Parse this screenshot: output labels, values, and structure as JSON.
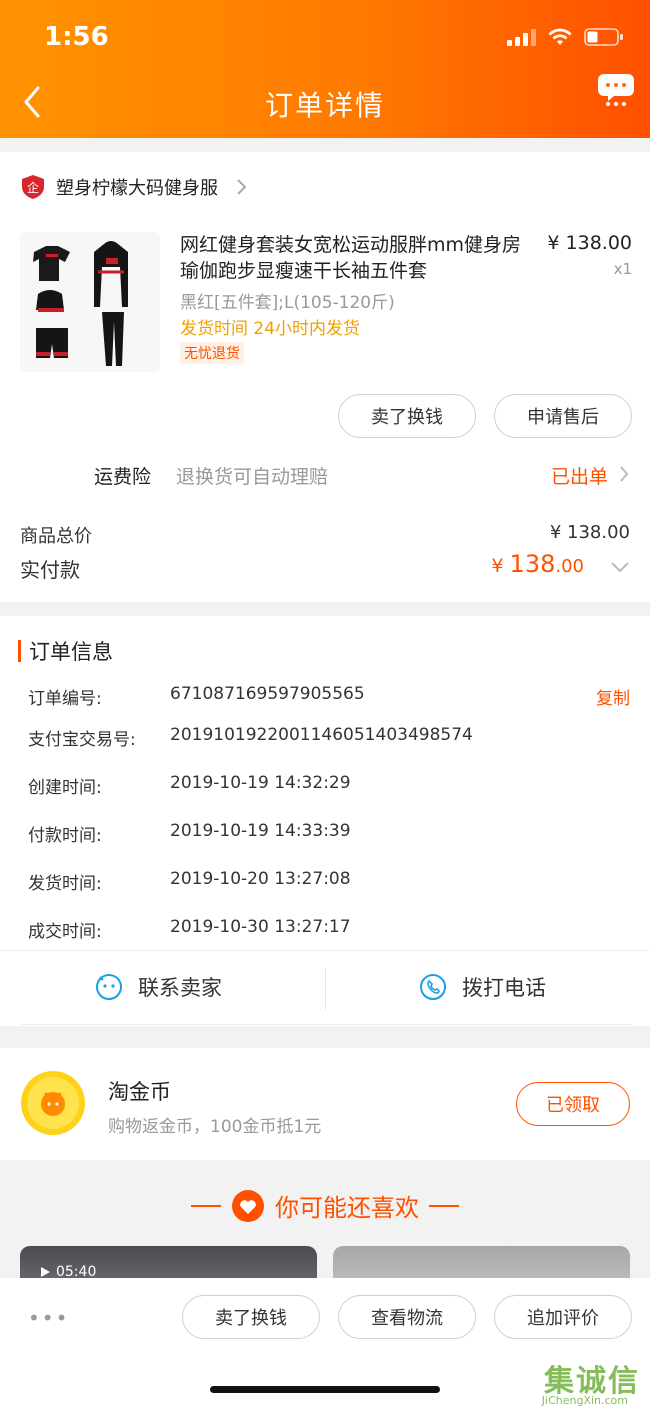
{
  "status_bar": {
    "time": "1:56"
  },
  "nav": {
    "title": "订单详情"
  },
  "shop": {
    "name": "塑身柠檬大码健身服"
  },
  "product": {
    "title": "网红健身套装女宽松运动服胖mm健身房瑜伽跑步显瘦速干长袖五件套",
    "price": "¥ 138.00",
    "quantity": "x1",
    "sku": "黑红[五件套];L(105-120斤)",
    "shipping": "发货时间  24小时内发货",
    "tag": "无忧退货",
    "actions": {
      "sell_label": "卖了换钱",
      "aftersale_label": "申请售后"
    }
  },
  "insurance": {
    "label": "运费险",
    "desc": "退换货可自动理赔",
    "status": "已出单"
  },
  "totals": {
    "goods_label": "商品总价",
    "goods_value": "¥ 138.00",
    "paid_label": "实付款",
    "paid_symbol": "¥ ",
    "paid_int": "138",
    "paid_dec": ".00"
  },
  "order_info": {
    "title": "订单信息",
    "copy_label": "复制",
    "rows": [
      {
        "label": "订单编号:",
        "value": "671087169597905565"
      },
      {
        "label": "支付宝交易号:",
        "value": "2019101922001146051403498574"
      },
      {
        "label": "创建时间:",
        "value": "2019-10-19 14:32:29"
      },
      {
        "label": "付款时间:",
        "value": "2019-10-19 14:33:39"
      },
      {
        "label": "发货时间:",
        "value": "2019-10-20 13:27:08"
      },
      {
        "label": "成交时间:",
        "value": "2019-10-30 13:27:17"
      }
    ],
    "contact_seller": "联系卖家",
    "call_phone": "拨打电话"
  },
  "coins": {
    "title": "淘金币",
    "desc": "购物返金币，100金币抵1元",
    "button": "已领取"
  },
  "recommend": {
    "title": "你可能还喜欢",
    "video_duration": "05:40"
  },
  "bottom_bar": {
    "more": "•••",
    "buttons": [
      "卖了换钱",
      "查看物流",
      "追加评价"
    ]
  },
  "watermark": {
    "main": "集诚信",
    "sub": "JiChengXin.com"
  },
  "colors": {
    "accent": "#ff5000",
    "header_start": "#ff9300",
    "warning": "#f0a000"
  }
}
